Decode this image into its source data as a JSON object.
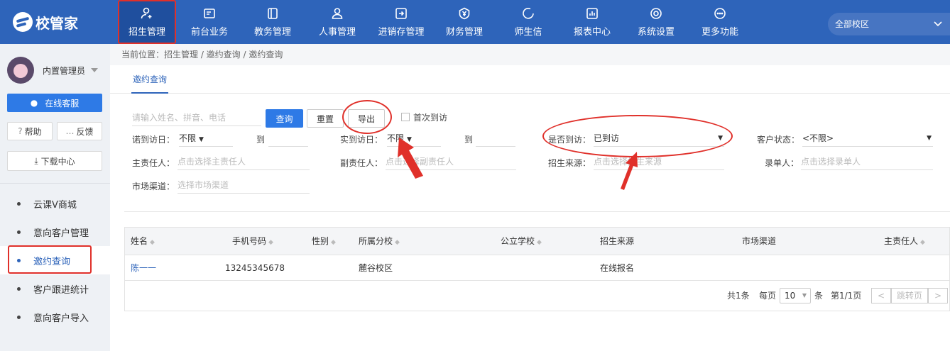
{
  "brand": {
    "name": "校管家"
  },
  "nav": [
    {
      "label": "招生管理",
      "icon": "user-add-icon"
    },
    {
      "label": "前台业务",
      "icon": "reception-icon"
    },
    {
      "label": "教务管理",
      "icon": "book-icon"
    },
    {
      "label": "人事管理",
      "icon": "person-icon"
    },
    {
      "label": "进销存管理",
      "icon": "inventory-icon"
    },
    {
      "label": "财务管理",
      "icon": "yuan-shield-icon"
    },
    {
      "label": "师生信",
      "icon": "chat-icon"
    },
    {
      "label": "报表中心",
      "icon": "chart-icon"
    },
    {
      "label": "系统设置",
      "icon": "gear-icon"
    },
    {
      "label": "更多功能",
      "icon": "more-icon"
    }
  ],
  "campus_select": {
    "value": "全部校区"
  },
  "sidebar": {
    "user": "内置管理员",
    "online_service": "在线客服",
    "help": "帮助",
    "feedback": "反馈",
    "download": "下载中心",
    "items": [
      {
        "label": "云课V商城"
      },
      {
        "label": "意向客户管理"
      },
      {
        "label": "邀约查询"
      },
      {
        "label": "客户跟进统计"
      },
      {
        "label": "意向客户导入"
      }
    ]
  },
  "breadcrumb": "当前位置：招生管理 / 邀约查询 / 邀约查询",
  "tab": "邀约查询",
  "filters": {
    "search_placeholder": "请输入姓名、拼音、电话",
    "query": "查询",
    "reset": "重置",
    "export": "导出",
    "first_visit": "首次到访",
    "promise_label": "诺到访日：",
    "promise_from": "不限",
    "to1": "到",
    "actual_label": "实到访日：",
    "actual_from": "不限",
    "to2": "到",
    "visited_label": "是否到访：",
    "visited_value": "已到访",
    "status_label": "客户状态：",
    "status_value": "<不限>",
    "owner_label": "主责任人：",
    "owner_ph": "点击选择主责任人",
    "deputy_label": "副责任人：",
    "deputy_ph": "点击选择副责任人",
    "source_label": "招生来源：",
    "source_ph": "点击选择招生来源",
    "recorder_label": "录单人：",
    "recorder_ph": "点击选择录单人",
    "channel_label": "市场渠道：",
    "channel_ph": "选择市场渠道"
  },
  "table": {
    "headers": [
      "姓名",
      "手机号码",
      "性别",
      "所属分校",
      "公立学校",
      "招生来源",
      "市场渠道",
      "主责任人"
    ],
    "rows": [
      [
        "陈一一",
        "13245345678",
        "",
        "麓谷校区",
        "",
        "在线报名",
        "",
        ""
      ]
    ]
  },
  "pager": {
    "total": "共1条",
    "per_page_label": "每页",
    "per_page": "10",
    "unit": "条",
    "page": "第1/1页",
    "prev": "<",
    "jump": "跳转页",
    "next": ">"
  },
  "colors": {
    "header": "#2e64ba",
    "accent": "#2e7ae6",
    "annotation": "#e0302a"
  }
}
